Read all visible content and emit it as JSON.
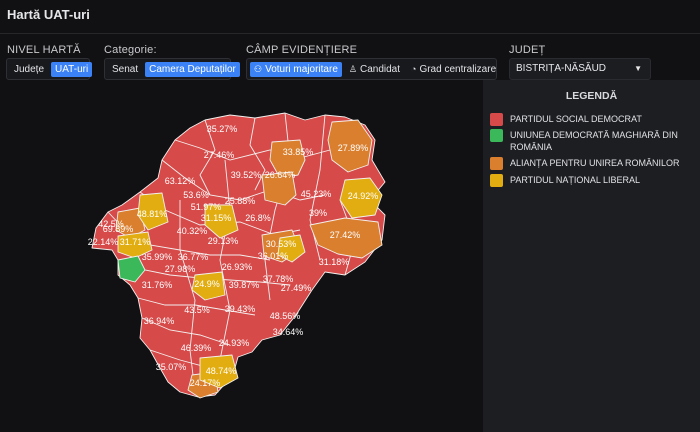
{
  "header": {
    "title": "Hartă UAT-uri"
  },
  "level": {
    "label": "NIVEL HARTĂ",
    "options": [
      "Județe",
      "UAT-uri"
    ],
    "selected": "UAT-uri"
  },
  "category": {
    "label": "Categorie:",
    "options": [
      "Senat",
      "Camera Deputaților"
    ],
    "selected": "Camera Deputaților"
  },
  "field": {
    "label": "CÂMP EVIDENȚIERE",
    "options": [
      {
        "label": "Voturi majoritare",
        "icon": "network-icon"
      },
      {
        "label": "Candidat",
        "icon": "person-icon"
      },
      {
        "label": "Grad centralizare",
        "icon": "gauge-icon"
      }
    ],
    "selected": "Voturi majoritare"
  },
  "county": {
    "label": "JUDEȚ",
    "value": "BISTRIȚA-NĂSĂUD"
  },
  "legend": {
    "title": "LEGENDĂ",
    "items": [
      {
        "label": "PARTIDUL SOCIAL DEMOCRAT",
        "color": "#d64a4a"
      },
      {
        "label": "UNIUNEA DEMOCRATĂ MAGHIARĂ DIN ROMÂNIA",
        "color": "#3bb85a"
      },
      {
        "label": "ALIANȚA PENTRU UNIREA ROMÂNILOR",
        "color": "#d97f2e"
      },
      {
        "label": "PARTIDUL NAȚIONAL LIBERAL",
        "color": "#e2ad10"
      }
    ]
  },
  "map_labels": [
    "35.27%",
    "27.46%",
    "33.85%",
    "27.89%",
    "39.52%",
    "26.64%",
    "63.12%",
    "53.6%",
    "45.23%",
    "24.92%",
    "48.81%",
    "51.97%",
    "25.88%",
    "39%",
    "42.5%",
    "26.8%",
    "31.15%",
    "69.89%",
    "40.32%",
    "27.42%",
    "22.14%",
    "31.71%",
    "29.13%",
    "30.53%",
    "35.99%",
    "36.77%",
    "36.01%",
    "27.98%",
    "31.18%",
    "26.93%",
    "37.78%",
    "24.9%",
    "39.87%",
    "31.76%",
    "27.49%",
    "43.5%",
    "39.43%",
    "36.94%",
    "48.56%",
    "34.64%",
    "46.39%",
    "24.93%",
    "35.07%",
    "48.74%",
    "24.17%"
  ]
}
